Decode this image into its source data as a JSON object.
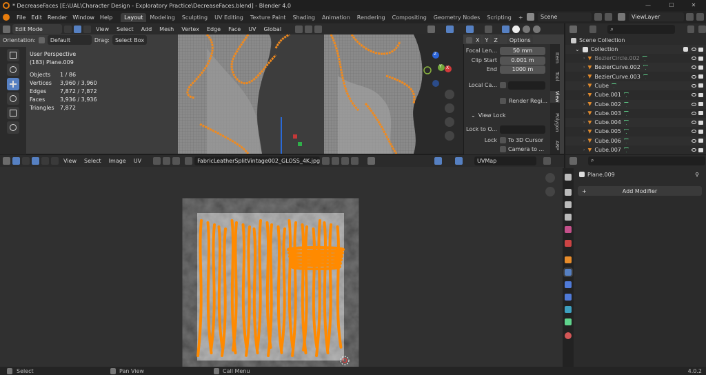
{
  "titlebar": {
    "title": "* DecreaseFaces [E:\\UAL\\Character Design - Exploratory Practice\\DecreaseFaces.blend] - Blender 4.0",
    "minimize": "—",
    "maximize": "☐",
    "close": "✕"
  },
  "menu": [
    "File",
    "Edit",
    "Render",
    "Window",
    "Help"
  ],
  "workspaces": [
    {
      "label": "Layout",
      "active": true
    },
    {
      "label": "Modeling"
    },
    {
      "label": "Sculpting"
    },
    {
      "label": "UV Editing"
    },
    {
      "label": "Texture Paint"
    },
    {
      "label": "Shading"
    },
    {
      "label": "Animation"
    },
    {
      "label": "Rendering"
    },
    {
      "label": "Compositing"
    },
    {
      "label": "Geometry Nodes"
    },
    {
      "label": "Scripting"
    }
  ],
  "add_workspace": "+",
  "scene": {
    "label": "Scene",
    "viewlayer": "ViewLayer"
  },
  "viewport": {
    "mode": "Edit Mode",
    "menus": [
      "View",
      "Select",
      "Add",
      "Mesh",
      "Vertex",
      "Edge",
      "Face",
      "UV"
    ],
    "transform": "Global",
    "orientation_label": "Orientation:",
    "orientation_value": "Default",
    "drag_label": "Drag:",
    "drag_value": "Select Box",
    "options": "Options",
    "axes": {
      "x": "X",
      "y": "Y",
      "z": "Z"
    },
    "info": {
      "view": "User Perspective",
      "object": "(183) Plane.009",
      "rows": [
        {
          "k": "Objects",
          "v": "1 / 86"
        },
        {
          "k": "Vertices",
          "v": "3,960 / 3,960"
        },
        {
          "k": "Edges",
          "v": "7,872 / 7,872"
        },
        {
          "k": "Faces",
          "v": "3,936 / 3,936"
        },
        {
          "k": "Triangles",
          "v": "7,872"
        }
      ]
    }
  },
  "npanel": {
    "focal_label": "Focal Len...",
    "focal_value": "50 mm",
    "clip_start_label": "Clip Start",
    "clip_start_value": "0.001 m",
    "end_label": "End",
    "end_value": "1000 m",
    "local_cam_label": "Local Ca...",
    "render_region": "Render Regi...",
    "view_lock": "View Lock",
    "lock_to_label": "Lock to O...",
    "lock_label": "Lock",
    "to_3d_cursor": "To 3D Cursor",
    "camera_to": "Camera to ...",
    "tabs": [
      "Item",
      "Tool",
      "View",
      "Polygon",
      "ARP"
    ]
  },
  "outliner": {
    "search_placeholder": "",
    "scene_collection": "Scene Collection",
    "collection": "Collection",
    "items": [
      {
        "name": "BezierCircle.002",
        "dim": true
      },
      {
        "name": "BezierCurve.002"
      },
      {
        "name": "BezierCurve.003"
      },
      {
        "name": "Cube"
      },
      {
        "name": "Cube.001"
      },
      {
        "name": "Cube.002"
      },
      {
        "name": "Cube.003"
      },
      {
        "name": "Cube.004"
      },
      {
        "name": "Cube.005"
      },
      {
        "name": "Cube.006"
      },
      {
        "name": "Cube.007"
      }
    ]
  },
  "uv": {
    "menus": [
      "View",
      "Select",
      "Image",
      "UV"
    ],
    "image": "FabricLeatherSplitVintage002_GLOSS_4K.jpg",
    "uvmap": "UVMap"
  },
  "props": {
    "object": "Plane.009",
    "add_modifier": "Add Modifier"
  },
  "status": {
    "select": "Select",
    "pan": "Pan View",
    "call_menu": "Call Menu",
    "version": "4.0.2"
  },
  "colors": {
    "accent": "#5680c2",
    "uv": "#ff8a00",
    "curve": "#f08a1e"
  }
}
